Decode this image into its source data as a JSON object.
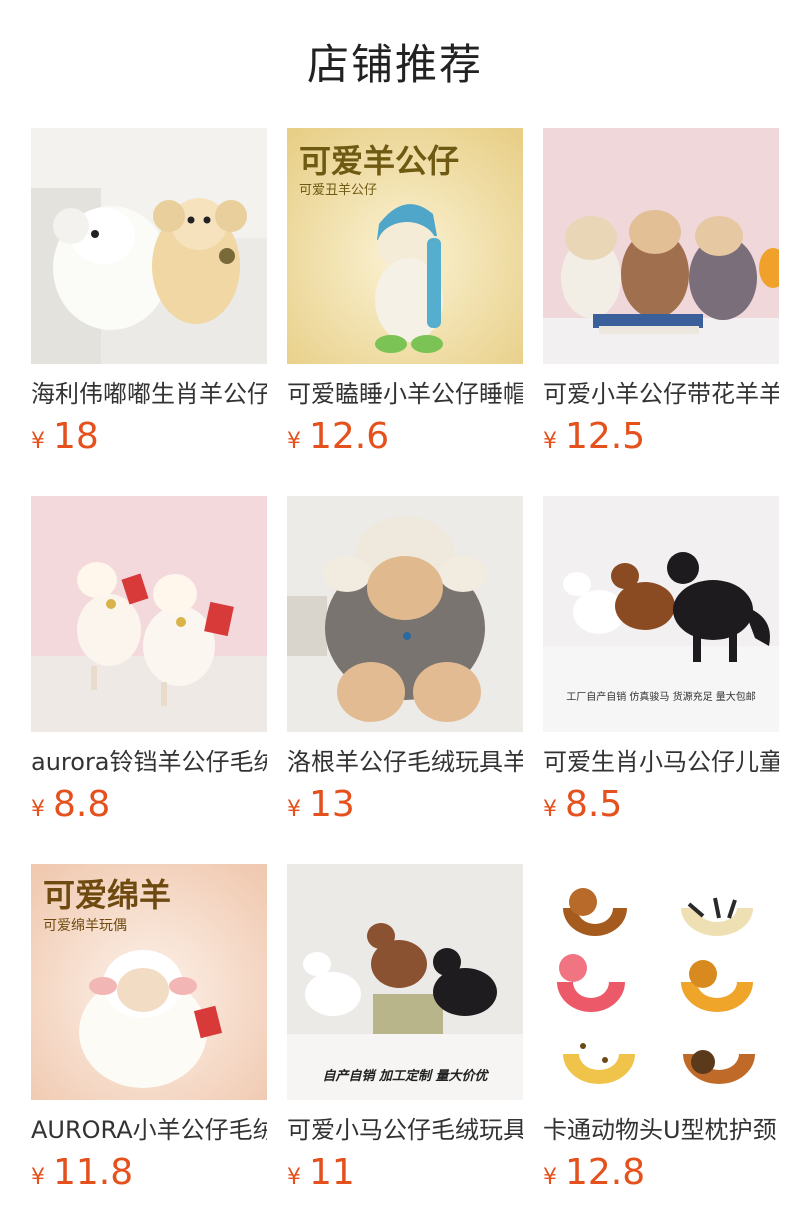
{
  "page": {
    "title": "店铺推荐"
  },
  "colors": {
    "price": "#e5511d",
    "text": "#333333",
    "title": "#222222"
  },
  "products": [
    {
      "name": "海利伟嘟嘟生肖羊公仔",
      "currency": "¥",
      "price": "18",
      "image_icon": "sheep-plush-icon"
    },
    {
      "name": "可爱瞌睡小羊公仔睡帽",
      "currency": "¥",
      "price": "12.6",
      "image_icon": "sleepy-sheep-icon",
      "image_text": {
        "headline": "可爱羊公仔",
        "sub": "可爱丑羊公仔"
      }
    },
    {
      "name": "可爱小羊公仔带花羊羊",
      "currency": "¥",
      "price": "12.5",
      "image_icon": "sheep-trio-icon"
    },
    {
      "name": "aurora铃铛羊公仔毛绒",
      "currency": "¥",
      "price": "8.8",
      "image_icon": "bell-sheep-icon"
    },
    {
      "name": "洛根羊公仔毛绒玩具羊",
      "currency": "¥",
      "price": "13",
      "image_icon": "logan-sheep-icon"
    },
    {
      "name": "可爱生肖小马公仔儿童",
      "currency": "¥",
      "price": "8.5",
      "image_icon": "horse-plush-icon",
      "image_text": {
        "caption": "工厂自产自销  仿真骏马  货源充足  量大包邮"
      }
    },
    {
      "name": "AURORA小羊公仔毛绒",
      "currency": "¥",
      "price": "11.8",
      "image_icon": "fluffy-sheep-icon",
      "image_text": {
        "headline": "可爱绵羊",
        "sub": "可爱绵羊玩偶"
      }
    },
    {
      "name": "可爱小马公仔毛绒玩具",
      "currency": "¥",
      "price": "11",
      "image_icon": "pony-trio-icon",
      "image_text": {
        "caption": "自产自销  加工定制  量大价优"
      }
    },
    {
      "name": "卡通动物头U型枕护颈",
      "currency": "¥",
      "price": "12.8",
      "image_icon": "u-pillow-icon"
    }
  ]
}
